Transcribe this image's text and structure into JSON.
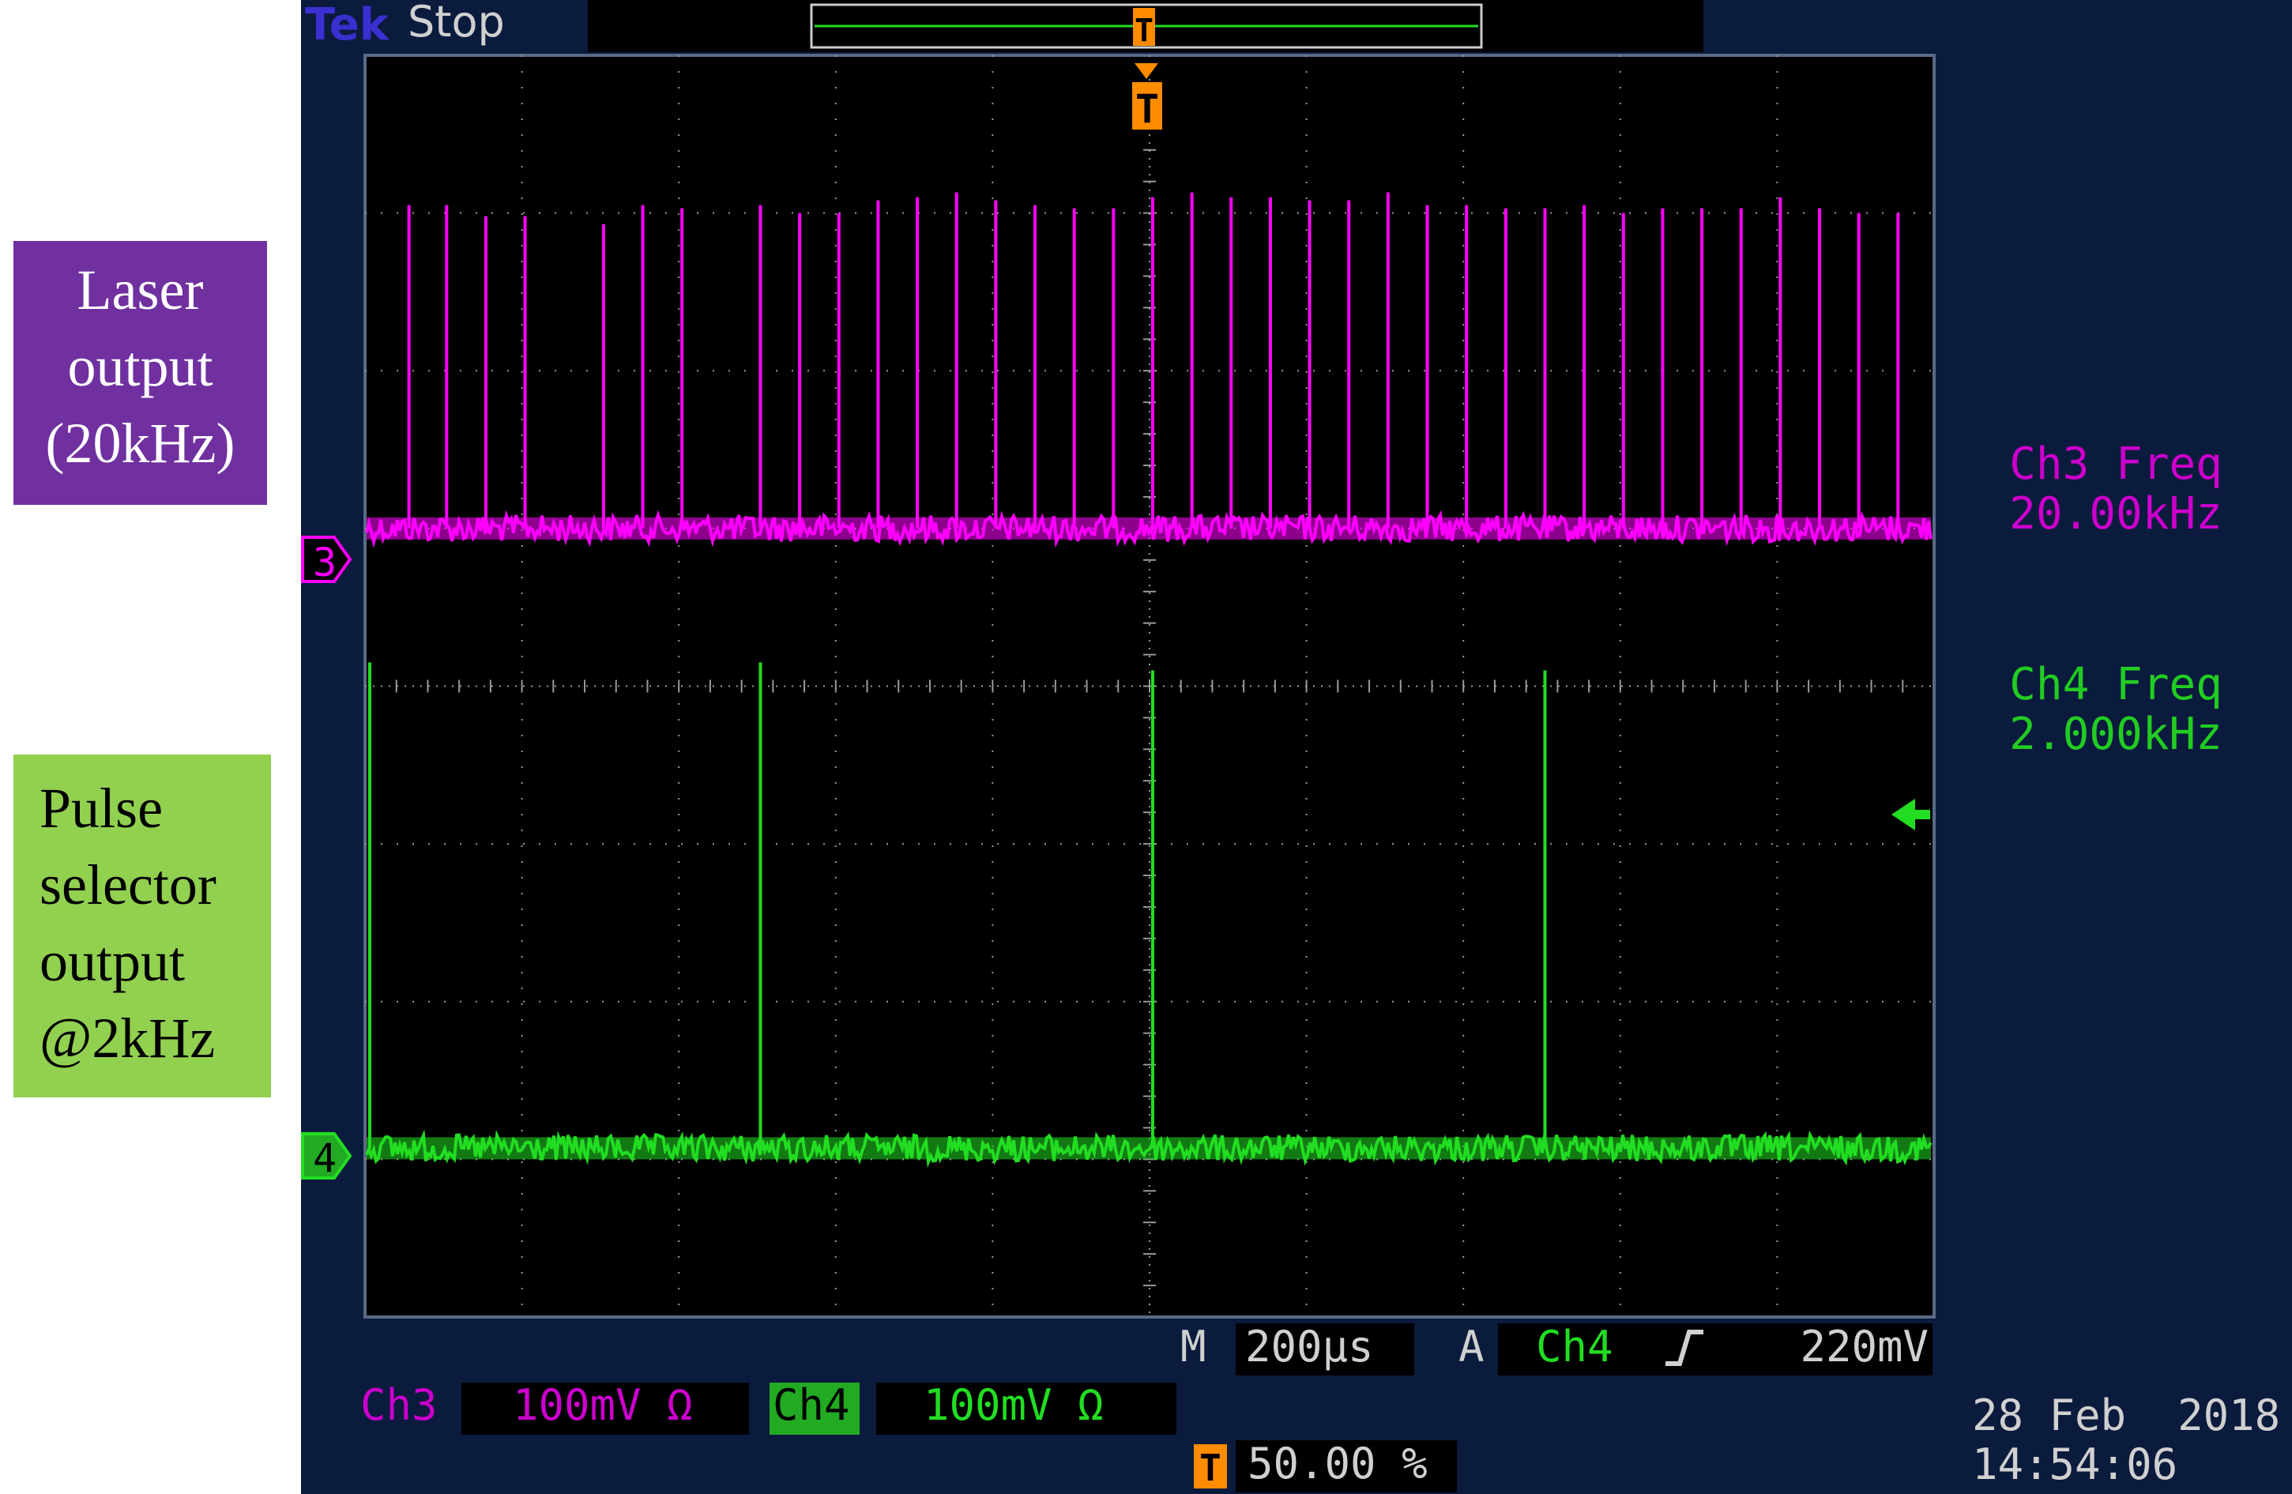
{
  "labels": {
    "laser": [
      "Laser",
      "output",
      "(20kHz)"
    ],
    "pulse": [
      "Pulse",
      "selector",
      "output",
      "@2kHz"
    ]
  },
  "scope": {
    "brand": "Tek",
    "state": "Stop",
    "ch3_marker": "3",
    "ch4_marker": "4",
    "trigger_glyph": "T",
    "ch3_measure": {
      "name": "Ch3 Freq",
      "value": "20.00kHz"
    },
    "ch4_measure": {
      "name": "Ch4 Freq",
      "value": "2.000kHz"
    },
    "timebase": {
      "prefix": "M",
      "value": "200µs"
    },
    "trigger": {
      "prefix": "A",
      "source": "Ch4",
      "slope": "rising-edge-icon",
      "level": "220mV"
    },
    "ch3_setting": {
      "label": "Ch3",
      "value": "100mV Ω"
    },
    "ch4_setting": {
      "label": "Ch4",
      "value": "100mV Ω"
    },
    "trigger_position": "50.00 %",
    "date": "28 Feb  2018",
    "time": "14:54:06",
    "colors": {
      "ch3": "#ff00ff",
      "ch4": "#22dd22",
      "trigger": "#ff8c00",
      "ch3_text": "#cc00cc",
      "grid": "#9a9a9a",
      "bg": "#000000",
      "frame": "#0b1b3d"
    }
  },
  "chart_data": {
    "type": "line",
    "x_unit": "divisions",
    "xlim": [
      0,
      10
    ],
    "ylim": [
      0,
      8
    ],
    "series": [
      {
        "name": "Ch3 Freq",
        "color": "#ff00ff",
        "baseline": 5.0,
        "pulse_x": [
          0.28,
          0.52,
          0.77,
          1.02,
          1.52,
          1.77,
          2.02,
          2.52,
          2.77,
          3.02,
          3.27,
          3.52,
          3.77,
          4.02,
          4.27,
          4.52,
          4.77,
          5.02,
          5.27,
          5.52,
          5.77,
          6.02,
          6.27,
          6.52,
          6.77,
          7.02,
          7.27,
          7.52,
          7.77,
          8.02,
          8.27,
          8.52,
          8.77,
          9.02,
          9.27,
          9.52,
          9.77
        ],
        "pulse_y": [
          7.05,
          7.05,
          6.98,
          6.98,
          6.93,
          7.05,
          7.03,
          7.05,
          7.0,
          7.0,
          7.08,
          7.1,
          7.13,
          7.08,
          7.05,
          7.03,
          7.03,
          7.1,
          7.13,
          7.1,
          7.1,
          7.08,
          7.08,
          7.13,
          7.05,
          7.05,
          7.03,
          7.03,
          7.05,
          7.0,
          7.03,
          7.03,
          7.03,
          7.1,
          7.03,
          7.0,
          7.0
        ]
      },
      {
        "name": "Ch4 Freq",
        "color": "#22dd22",
        "baseline": 1.07,
        "pulse_x": [
          0.03,
          2.52,
          5.02,
          7.52
        ],
        "pulse_y": [
          4.15,
          4.15,
          4.1,
          4.1
        ]
      }
    ]
  }
}
